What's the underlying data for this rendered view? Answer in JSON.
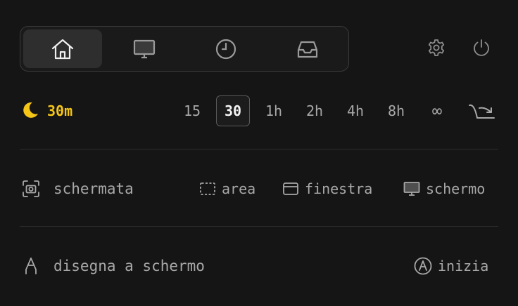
{
  "tabs": [
    {
      "icon": "home-icon",
      "active": true
    },
    {
      "icon": "monitor-icon",
      "active": false
    },
    {
      "icon": "clock-icon",
      "active": false
    },
    {
      "icon": "inbox-icon",
      "active": false
    }
  ],
  "top_actions": [
    {
      "icon": "gear-icon"
    },
    {
      "icon": "power-icon"
    }
  ],
  "sleep": {
    "icon": "moon-icon",
    "current": "30m",
    "accent_color": "#f5c518",
    "options": [
      "15",
      "30",
      "1h",
      "2h",
      "4h",
      "8h",
      "∞"
    ],
    "selected": "30",
    "action_icon": "sleep-now-icon"
  },
  "screenshot": {
    "icon": "camera-icon",
    "label": "schermata",
    "options": [
      {
        "icon": "area-select-icon",
        "label": "area"
      },
      {
        "icon": "window-icon",
        "label": "finestra"
      },
      {
        "icon": "monitor-icon",
        "label": "schermo"
      }
    ]
  },
  "draw": {
    "icon": "pen-nib-icon",
    "label": "disegna a schermo",
    "start_icon": "pen-circle-icon",
    "start_label": "inizia"
  }
}
